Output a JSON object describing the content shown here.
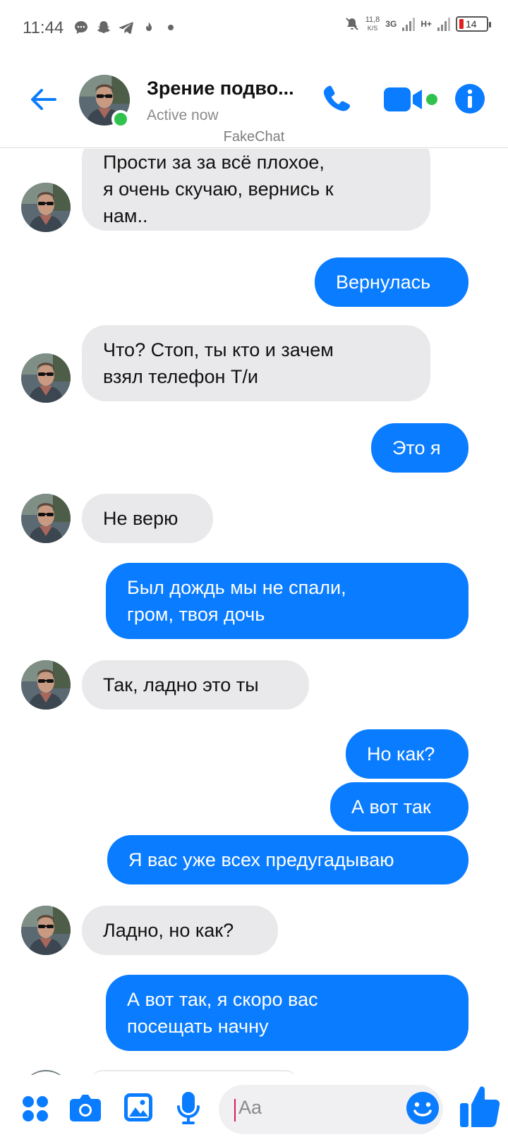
{
  "status_bar": {
    "time": "11:44",
    "speed": "11,8",
    "speed_unit": "K/S",
    "net_3g": "3G",
    "net_h": "H+",
    "battery": "14"
  },
  "header": {
    "contact_name": "Зрение подво...",
    "contact_status": "Active now",
    "watermark": "FakeChat"
  },
  "messages": [
    {
      "side": "in",
      "text": "Прости за за всё плохое,\nя очень скучаю, вернись к\nнам.."
    },
    {
      "side": "out",
      "text": "Вернулась"
    },
    {
      "side": "in",
      "text": "Что? Стоп, ты кто и зачем\nвзял телефон Т/и"
    },
    {
      "side": "out",
      "text": "Это я"
    },
    {
      "side": "in",
      "text": "Не верю"
    },
    {
      "side": "out",
      "text": "Был дождь мы не спали,\nгром, твоя дочь"
    },
    {
      "side": "in",
      "text": "Так, ладно это ты"
    },
    {
      "side": "out",
      "text": "Но как?"
    },
    {
      "side": "out",
      "text": "А вот так"
    },
    {
      "side": "out",
      "text": "Я вас уже всех предугадываю"
    },
    {
      "side": "in",
      "text": "Ладно, но как?"
    },
    {
      "side": "out",
      "text": "А вот так, я скоро вас\nпосещать начну"
    }
  ],
  "composer": {
    "placeholder": "Aa"
  },
  "colors": {
    "accent": "#0a7cff",
    "incoming_bubble": "#e9e9eb",
    "online": "#31c24d"
  },
  "icons": [
    "back-arrow-icon",
    "phone-icon",
    "video-camera-icon",
    "info-icon",
    "apps-icon",
    "camera-icon",
    "gallery-icon",
    "microphone-icon",
    "emoji-icon",
    "thumbs-up-icon"
  ]
}
